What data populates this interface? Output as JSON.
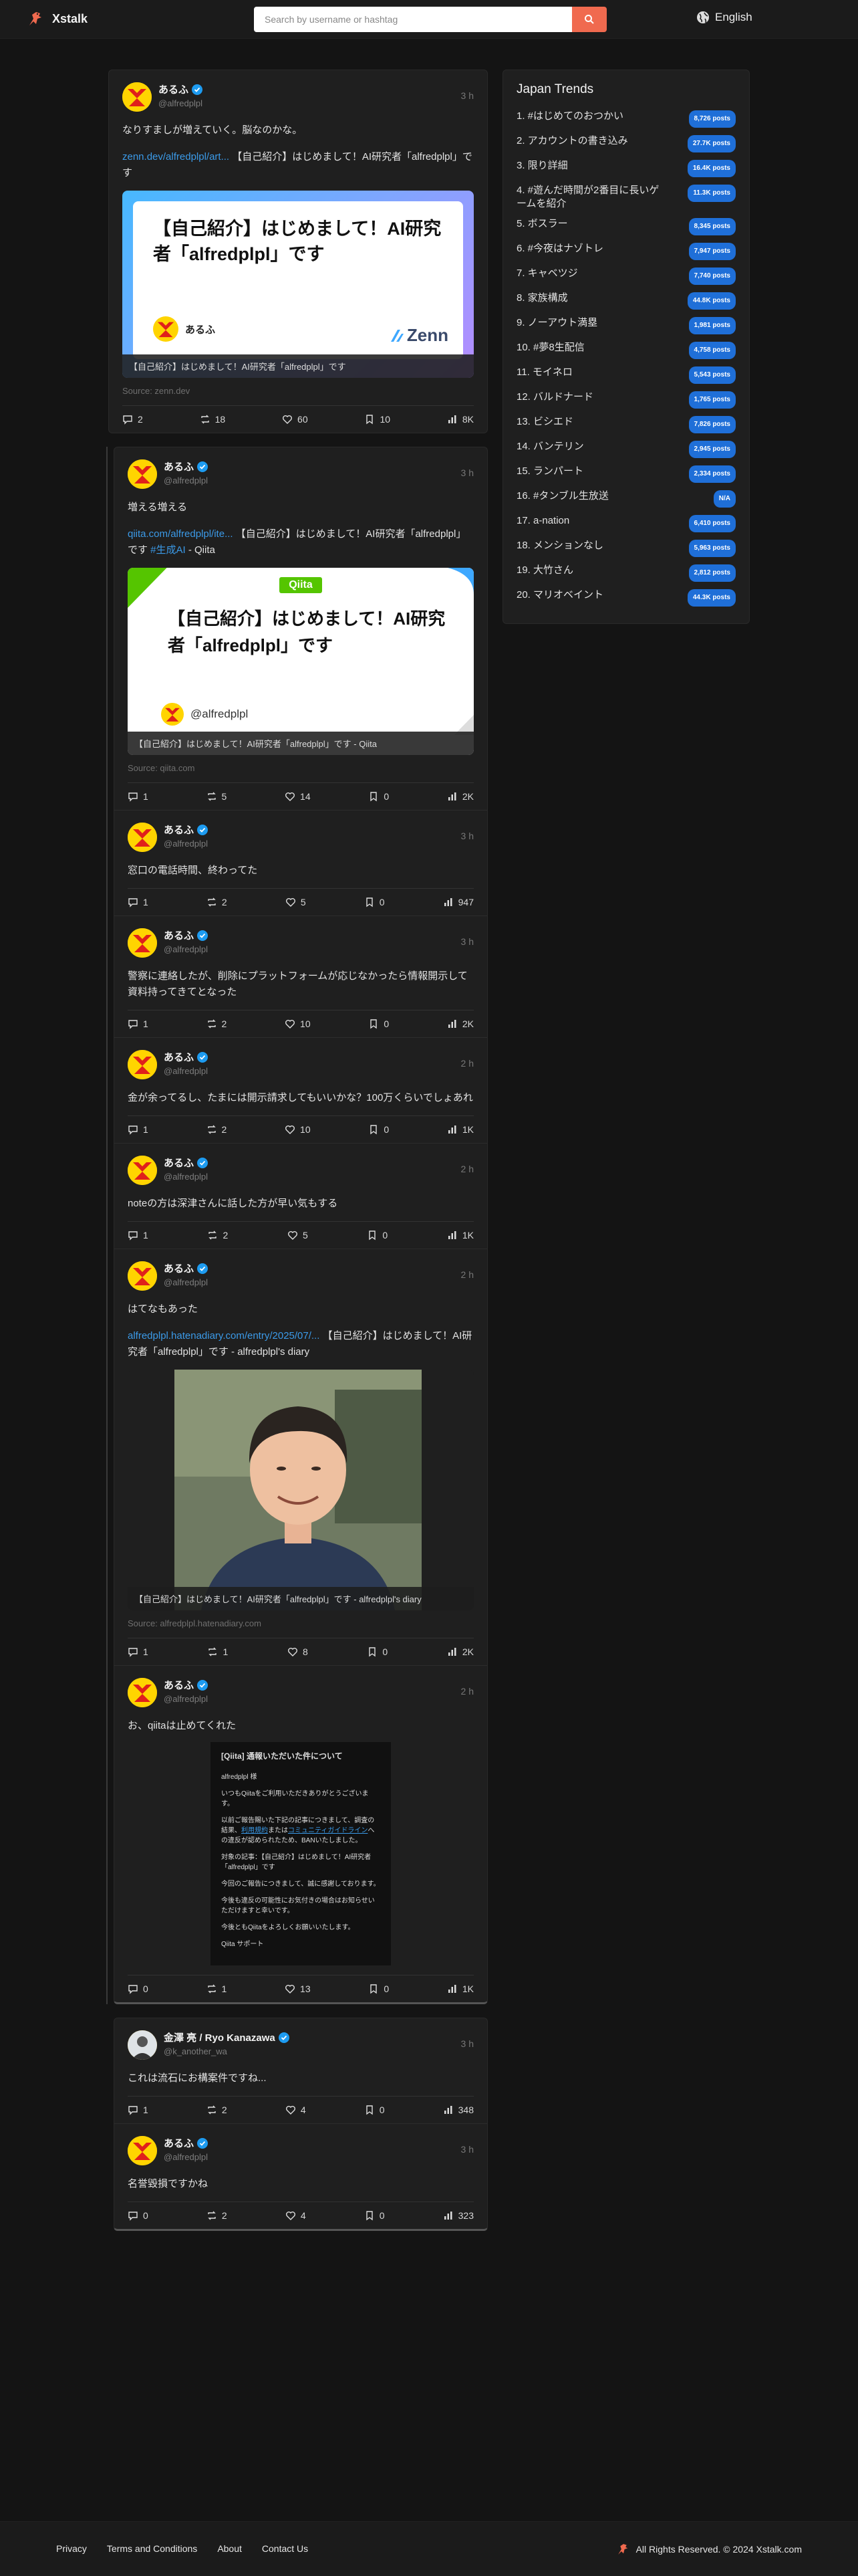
{
  "header": {
    "brand": "Xstalk",
    "search_placeholder": "Search by username or hashtag",
    "language": "English"
  },
  "colors": {
    "accent": "#f06a4f",
    "link": "#3b9ae8",
    "badge": "#1f6fd8",
    "background": "#141414"
  },
  "feed": {
    "top_tweet": {
      "name": "あるふ",
      "handle": "@alfredplpl",
      "time": "3 h",
      "text": "なりすましが増えていく。脳なのかな。",
      "link": "zenn.dev/alfredplpl/art...",
      "link_rest": " 【自己紹介】はじめまして！AI研究者「alfredplpl」です",
      "ogp_title": "【自己紹介】はじめまして！AI研究者「alfredplpl」です",
      "ogp_author": "あるふ",
      "ogp_brand": "Zenn",
      "ogp_caption": "【自己紹介】はじめまして！AI研究者「alfredplpl」です",
      "source": "Source: zenn.dev",
      "replies": "2",
      "retweets": "18",
      "likes": "60",
      "bookmarks": "10",
      "views": "8K"
    },
    "thread1": [
      {
        "name": "あるふ",
        "handle": "@alfredplpl",
        "time": "3 h",
        "text": "増える増える",
        "link": "qiita.com/alfredplpl/ite...",
        "link_rest": " 【自己紹介】はじめまして！AI研究者「alfredplpl」です ",
        "hashtag": "#生成AI",
        "link_tail": " - Qiita",
        "ogp_brand": "Qiita",
        "ogp_title": "【自己紹介】はじめまして！AI研究者「alfredplpl」です",
        "ogp_author": "@alfredplpl",
        "ogp_caption": "【自己紹介】はじめまして！AI研究者「alfredplpl」です - Qiita",
        "source": "Source: qiita.com",
        "replies": "1",
        "retweets": "5",
        "likes": "14",
        "bookmarks": "0",
        "views": "2K"
      },
      {
        "name": "あるふ",
        "handle": "@alfredplpl",
        "time": "3 h",
        "text": "窓口の電話時間、終わってた",
        "replies": "1",
        "retweets": "2",
        "likes": "5",
        "bookmarks": "0",
        "views": "947"
      },
      {
        "name": "あるふ",
        "handle": "@alfredplpl",
        "time": "3 h",
        "text": "警察に連絡したが、削除にプラットフォームが応じなかったら情報開示して資料持ってきてとなった",
        "replies": "1",
        "retweets": "2",
        "likes": "10",
        "bookmarks": "0",
        "views": "2K"
      },
      {
        "name": "あるふ",
        "handle": "@alfredplpl",
        "time": "2 h",
        "text": "金が余ってるし、たまには開示請求してもいいかな？100万くらいでしょあれ",
        "replies": "1",
        "retweets": "2",
        "likes": "10",
        "bookmarks": "0",
        "views": "1K"
      },
      {
        "name": "あるふ",
        "handle": "@alfredplpl",
        "time": "2 h",
        "text": "noteの方は深津さんに話した方が早い気もする",
        "replies": "1",
        "retweets": "2",
        "likes": "5",
        "bookmarks": "0",
        "views": "1K"
      },
      {
        "name": "あるふ",
        "handle": "@alfredplpl",
        "time": "2 h",
        "text": "はてなもあった",
        "link": "alfredplpl.hatenadiary.com/entry/2025/07/...",
        "link_rest": " 【自己紹介】はじめまして！AI研究者「alfredplpl」です - alfredplpl's diary",
        "ogp_caption": "【自己紹介】はじめまして！AI研究者「alfredplpl」です - alfredplpl's diary",
        "source": "Source: alfredplpl.hatenadiary.com",
        "replies": "1",
        "retweets": "1",
        "likes": "8",
        "bookmarks": "0",
        "views": "2K"
      },
      {
        "name": "あるふ",
        "handle": "@alfredplpl",
        "time": "2 h",
        "text": "お、qiitaは止めてくれた",
        "mail_title": "[Qiita] 通報いただいた件について",
        "mail_to": "alfredplpl 様",
        "mail_p1": "いつもQiitaをご利用いただきありがとうございます。",
        "mail_p2a": "以前ご報告賜いた下記の記事につきまして、調査の結果、",
        "mail_p2_link1": "利用規約",
        "mail_p2b": "または",
        "mail_p2_link2": "コミュニティガイドライン",
        "mail_p2c": "への違反が認められたため、BANいたしました。",
        "mail_p3": "対象の記事：【自己紹介】はじめまして！AI研究者「alfredplpl」です",
        "mail_p4": "今回のご報告につきまして、誠に感謝しております。",
        "mail_p5": "今後も違反の可能性にお気付きの場合はお知らせいただけますと幸いです。",
        "mail_p6": "今後ともQiitaをよろしくお願いいたします。",
        "mail_sign": "Qiita サポート",
        "replies": "0",
        "retweets": "1",
        "likes": "13",
        "bookmarks": "0",
        "views": "1K"
      }
    ],
    "thread2": [
      {
        "name": "金澤 亮 / Ryo Kanazawa",
        "handle": "@k_another_wa",
        "time": "3 h",
        "text": "これは流石にお構案件ですね...",
        "replies": "1",
        "retweets": "2",
        "likes": "4",
        "bookmarks": "0",
        "views": "348"
      },
      {
        "name": "あるふ",
        "handle": "@alfredplpl",
        "time": "3 h",
        "text": "名誉毀損ですかね",
        "replies": "0",
        "retweets": "2",
        "likes": "4",
        "bookmarks": "0",
        "views": "323"
      }
    ]
  },
  "trends": {
    "title": "Japan Trends",
    "items": [
      {
        "label": "1. #はじめてのおつかい",
        "count": "8,726 posts"
      },
      {
        "label": "2. アカウントの書き込み",
        "count": "27.7K posts"
      },
      {
        "label": "3. 限り詳細",
        "count": "16.4K posts"
      },
      {
        "label": "4. #遊んだ時間が2番目に長いゲームを紹介",
        "count": "11.3K posts"
      },
      {
        "label": "5. ボスラー",
        "count": "8,345 posts"
      },
      {
        "label": "6. #今夜はナゾトレ",
        "count": "7,947 posts"
      },
      {
        "label": "7. キャベツジ",
        "count": "7,740 posts"
      },
      {
        "label": "8. 家族構成",
        "count": "44.8K posts"
      },
      {
        "label": "9. ノーアウト満塁",
        "count": "1,981 posts"
      },
      {
        "label": "10. #夢8生配信",
        "count": "4,758 posts"
      },
      {
        "label": "11. モイネロ",
        "count": "5,543 posts"
      },
      {
        "label": "12. バルドナード",
        "count": "1,765 posts"
      },
      {
        "label": "13. ビシエド",
        "count": "7,826 posts"
      },
      {
        "label": "14. バンテリン",
        "count": "2,945 posts"
      },
      {
        "label": "15. ランパート",
        "count": "2,334 posts"
      },
      {
        "label": "16. #タンブル生放送",
        "count": "N/A"
      },
      {
        "label": "17. a-nation",
        "count": "6,410 posts"
      },
      {
        "label": "18. メンションなし",
        "count": "5,963 posts"
      },
      {
        "label": "19. 大竹さん",
        "count": "2,812 posts"
      },
      {
        "label": "20. マリオベイント",
        "count": "44.3K posts"
      }
    ]
  },
  "footer": {
    "links": [
      "Privacy",
      "Terms and Conditions",
      "About",
      "Contact Us"
    ],
    "copyright": "All Rights Reserved. © 2024 Xstalk.com"
  }
}
